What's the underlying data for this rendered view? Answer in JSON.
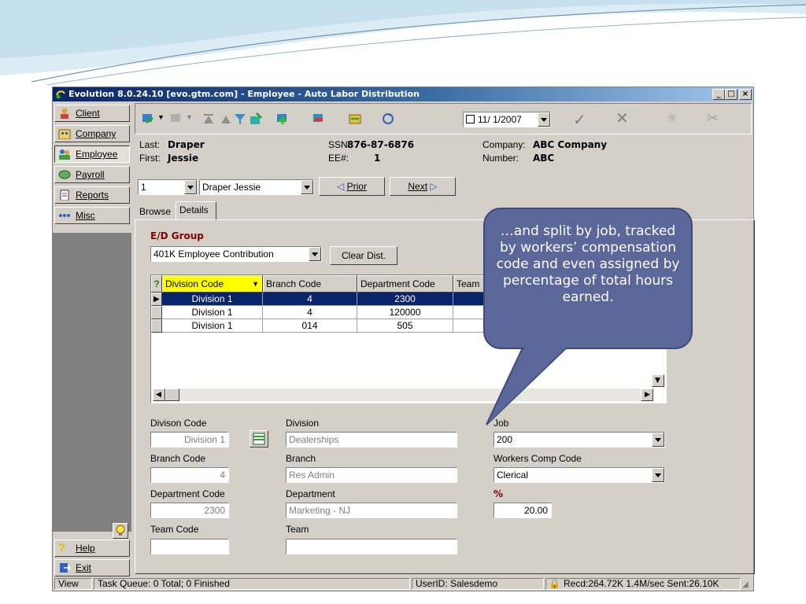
{
  "window": {
    "title": "Evolution 8.0.24.10 [evo.gtm.com] - Employee - Auto Labor Distribution",
    "controls": [
      "_",
      "□",
      "×"
    ]
  },
  "nav": {
    "items": [
      {
        "label": "Client",
        "icon": "client-icon"
      },
      {
        "label": "Company",
        "icon": "company-icon"
      },
      {
        "label": "Employee",
        "icon": "employee-icon"
      },
      {
        "label": "Payroll",
        "icon": "payroll-icon"
      },
      {
        "label": "Reports",
        "icon": "reports-icon"
      },
      {
        "label": "Misc",
        "icon": "misc-icon"
      }
    ],
    "help": "Help",
    "exit": "Exit"
  },
  "toolbar": {
    "date": "11/ 1/2007"
  },
  "employee": {
    "last_label": "Last:",
    "last": "Draper",
    "first_label": "First:",
    "first": "Jessie",
    "ssn_label": "SSN:",
    "ssn": "876-87-6876",
    "ee_label": "EE#:",
    "ee": "1",
    "company_label": "Company:",
    "company": "ABC Company",
    "number_label": "Number:",
    "number": "ABC"
  },
  "selector": {
    "index": "1",
    "name": "Draper Jessie",
    "prior": "Prior",
    "next": "Next"
  },
  "tabs": [
    "Browse",
    "Details"
  ],
  "ed_group": {
    "label": "E/D Group",
    "value": "401K Employee Contribution",
    "clear": "Clear Dist."
  },
  "grid": {
    "columns": [
      "Division Code",
      "Branch Code",
      "Department Code",
      "Team"
    ],
    "rows": [
      [
        "Division 1",
        "4",
        "2300",
        ""
      ],
      [
        "Division 1",
        "4",
        "120000",
        ""
      ],
      [
        "Division 1",
        "014",
        "505",
        ""
      ]
    ]
  },
  "form": {
    "division_code_label": "Divison Code",
    "division_code": "Division 1",
    "division_label": "Division",
    "division": "Dealerships",
    "branch_code_label": "Branch Code",
    "branch_code": "4",
    "branch_label": "Branch",
    "branch": "Res Admin",
    "department_code_label": "Department Code",
    "department_code": "2300",
    "department_label": "Department",
    "department": "Marketing - NJ",
    "team_code_label": "Team Code",
    "team_code": "",
    "team_label": "Team",
    "team": "",
    "job_label": "Job",
    "job": "200",
    "wc_label": "Workers Comp Code",
    "wc": "Clerical",
    "pct_label": "%",
    "pct": "20.00"
  },
  "status": {
    "view": "View",
    "queue": "Task Queue: 0 Total; 0 Finished",
    "user": "UserID: Salesdemo",
    "transfer": "Recd:264.72K 1.4M/sec  Sent:26.10K"
  },
  "callout": {
    "text": "…and split by job, tracked by workers’ compensation code and even assigned by percentage of total hours earned."
  },
  "colors": {
    "titlebar": "#0a246a",
    "grid_selected": "#0a246a",
    "header_active": "#ffff00",
    "callout": "#5b6799",
    "section_label": "#800000"
  }
}
